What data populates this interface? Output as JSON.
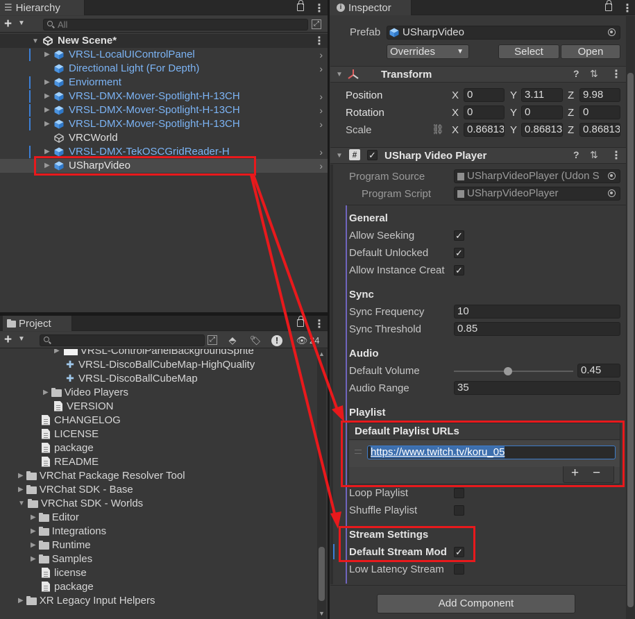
{
  "hierarchy": {
    "tab_label": "Hierarchy",
    "search_placeholder": "All",
    "scene_name": "New Scene*",
    "items": [
      {
        "label": "VRSL-LocalUIControlPanel"
      },
      {
        "label": "Directional Light (For Depth)"
      },
      {
        "label": "Enviorment"
      },
      {
        "label": "VRSL-DMX-Mover-Spotlight-H-13CH"
      },
      {
        "label": "VRSL-DMX-Mover-Spotlight-H-13CH"
      },
      {
        "label": "VRSL-DMX-Mover-Spotlight-H-13CH"
      },
      {
        "label": "VRCWorld"
      },
      {
        "label": "VRSL-DMX-TekOSCGridReader-H"
      },
      {
        "label": "USharpVideo"
      }
    ]
  },
  "project": {
    "tab_label": "Project",
    "hidden_count": "24",
    "items": [
      {
        "label": "VRSL-ControlPanelBackgroundSprite"
      },
      {
        "label": "VRSL-DiscoBallCubeMap-HighQuality"
      },
      {
        "label": "VRSL-DiscoBallCubeMap"
      },
      {
        "label": "Video Players"
      },
      {
        "label": "VERSION"
      },
      {
        "label": "CHANGELOG"
      },
      {
        "label": "LICENSE"
      },
      {
        "label": "package"
      },
      {
        "label": "README"
      },
      {
        "label": "VRChat Package Resolver Tool"
      },
      {
        "label": "VRChat SDK - Base"
      },
      {
        "label": "VRChat SDK - Worlds"
      },
      {
        "label": "Editor"
      },
      {
        "label": "Integrations"
      },
      {
        "label": "Runtime"
      },
      {
        "label": "Samples"
      },
      {
        "label": "license"
      },
      {
        "label": "package"
      },
      {
        "label": "XR Legacy Input Helpers"
      }
    ]
  },
  "inspector": {
    "tab_label": "Inspector",
    "prefab_label": "Prefab",
    "prefab_value": "USharpVideo",
    "overrides_label": "Overrides",
    "select_label": "Select",
    "open_label": "Open",
    "transform": {
      "title": "Transform",
      "position_label": "Position",
      "rotation_label": "Rotation",
      "scale_label": "Scale",
      "axis_x": "X",
      "axis_y": "Y",
      "axis_z": "Z",
      "position": {
        "x": "0",
        "y": "3.11",
        "z": "9.98"
      },
      "rotation": {
        "x": "0",
        "y": "0",
        "z": "0"
      },
      "scale": {
        "x": "0.86813",
        "y": "0.86813",
        "z": "0.86813"
      }
    },
    "player": {
      "title": "USharp Video Player",
      "program_source_label": "Program Source",
      "program_source_value": "USharpVideoPlayer (Udon S",
      "program_script_label": "Program Script",
      "program_script_value": "USharpVideoPlayer",
      "general_header": "General",
      "allow_seeking_label": "Allow Seeking",
      "default_unlocked_label": "Default Unlocked",
      "allow_instance_label": "Allow Instance Creat",
      "sync_header": "Sync",
      "sync_frequency_label": "Sync Frequency",
      "sync_frequency_value": "10",
      "sync_threshold_label": "Sync Threshold",
      "sync_threshold_value": "0.85",
      "audio_header": "Audio",
      "default_volume_label": "Default Volume",
      "default_volume_value": "0.45",
      "default_volume_fraction": 0.45,
      "audio_range_label": "Audio Range",
      "audio_range_value": "35",
      "playlist_header": "Playlist",
      "playlist_urls_label": "Default Playlist URLs",
      "playlist_url_0": "https://www.twitch.tv/koru_05",
      "add_label": "+",
      "remove_label": "−",
      "loop_playlist_label": "Loop Playlist",
      "shuffle_playlist_label": "Shuffle Playlist",
      "stream_header": "Stream Settings",
      "default_stream_label": "Default Stream Mod",
      "low_latency_label": "Low Latency Stream"
    },
    "add_component_label": "Add Component"
  },
  "colors": {
    "highlight_red": "#e8191c",
    "prefab_blue": "#7cb4f5",
    "selection_blue": "#3d6fae"
  }
}
